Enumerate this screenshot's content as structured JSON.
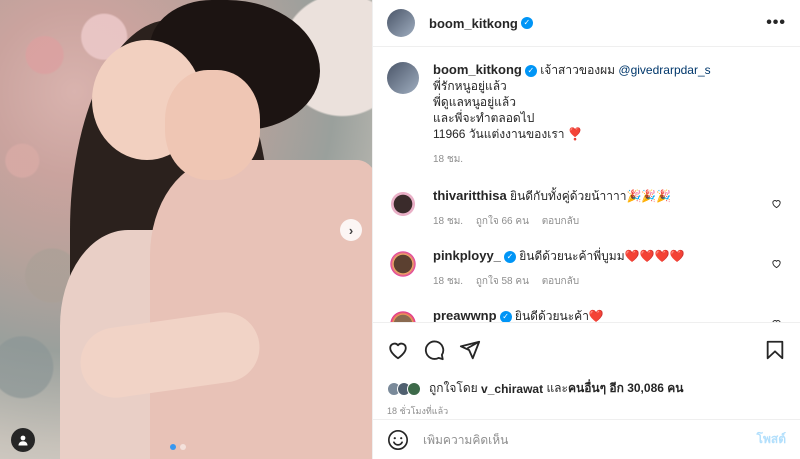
{
  "post": {
    "username": "boom_kitkong",
    "more_label": "•••"
  },
  "caption": {
    "username": "boom_kitkong",
    "line1_text": "เจ้าสาวของผม ",
    "mention": "@givedrarpdar_s",
    "lines": [
      "พี่รักหนูอยู่แล้ว",
      "พี่ดูแลหนูอยู่แล้ว",
      "และพี่จะทำตลอดไป",
      "11966 วันแต่งงานของเรา"
    ],
    "emoji": "❣️",
    "time": "18 ชม."
  },
  "comments": [
    {
      "username": "thivaritthisa",
      "text": "ยินดีกับทั้งคู่ด้วยน้าาาา🎉🎉🎉",
      "time": "18 ชม.",
      "likes": "ถูกใจ 66 คน",
      "reply": "ตอบกลับ"
    },
    {
      "username": "pinkployy_",
      "text": "ยินดีด้วยนะค้าพี่บูมม❤️❤️❤️❤️",
      "time": "18 ชม.",
      "likes": "ถูกใจ 58 คน",
      "reply": "ตอบกลับ"
    },
    {
      "username": "preawwnp",
      "text": "ยินดีด้วยนะค้า❤️",
      "time": "",
      "likes": "",
      "reply": ""
    }
  ],
  "likes": {
    "prefix": "ถูกใจโดย",
    "user": "v_chirawat",
    "middle": "และ",
    "others": "คนอื่นๆ อีก 30,086 คน"
  },
  "posted_time": "18 ชั่วโมงที่แล้ว",
  "comment_box": {
    "placeholder": "เพิ่มความคิดเห็น",
    "post_label": "โพสต์"
  },
  "photo": {
    "next_label": "›",
    "dot_count": 2
  },
  "colors": {
    "verified": "#0095f6",
    "link": "#00376b",
    "heart": "#ed4956"
  }
}
